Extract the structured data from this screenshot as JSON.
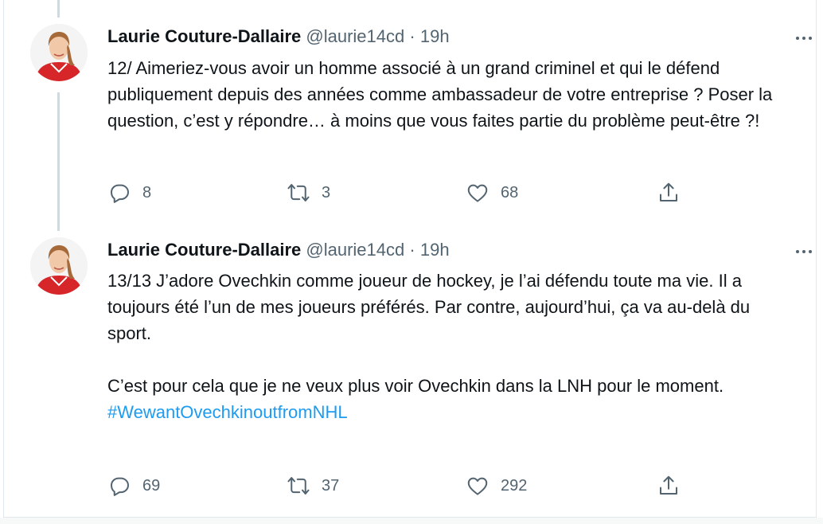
{
  "tweets": [
    {
      "author": "Laurie Couture-Dallaire",
      "handle": "@laurie14cd",
      "separator": "·",
      "time": "19h",
      "paragraphs": [
        "12/ Aimeriez-vous avoir un homme associé à un grand criminel et qui le défend publiquement depuis des années comme ambassadeur de votre entreprise ? Poser la question, c’est y répondre… à moins que vous faites partie du problème peut-être ?!"
      ],
      "hashtag": "",
      "replies": "8",
      "retweets": "3",
      "likes": "68"
    },
    {
      "author": "Laurie Couture-Dallaire",
      "handle": "@laurie14cd",
      "separator": "·",
      "time": "19h",
      "paragraphs": [
        "13/13 J’adore Ovechkin comme joueur de hockey, je l’ai défendu toute ma vie. Il a toujours été l’un de mes joueurs préférés. Par contre, aujourd’hui, ça va au-delà du sport.",
        "C’est pour cela que je ne veux plus voir Ovechkin dans la LNH pour le moment."
      ],
      "hashtag": "#WewantOvechkinoutfromNHL",
      "replies": "69",
      "retweets": "37",
      "likes": "292"
    }
  ],
  "icons": {
    "reply": "reply-icon",
    "retweet": "retweet-icon",
    "like": "heart-icon",
    "share": "share-icon",
    "more": "more-options-icon"
  },
  "colors": {
    "text": "#0f1419",
    "secondary": "#536471",
    "link": "#1d9bf0",
    "thread_line": "#cfd9de",
    "avatar_shirt": "#d7262a"
  }
}
